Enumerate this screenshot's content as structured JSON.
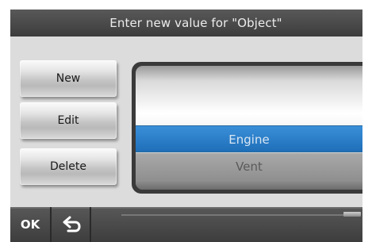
{
  "dialog": {
    "title": "Enter new value for  \"Object\""
  },
  "actions": {
    "new_label": "New",
    "edit_label": "Edit",
    "delete_label": "Delete"
  },
  "list": {
    "items": [
      "",
      "Engine",
      "Vent"
    ],
    "selected": "Engine"
  },
  "bottom_bar": {
    "ok_label": "OK",
    "back_icon": "back-arrow-icon"
  },
  "colors": {
    "selection": "#2a7fcc",
    "titlebar": "#4a4a4a"
  }
}
